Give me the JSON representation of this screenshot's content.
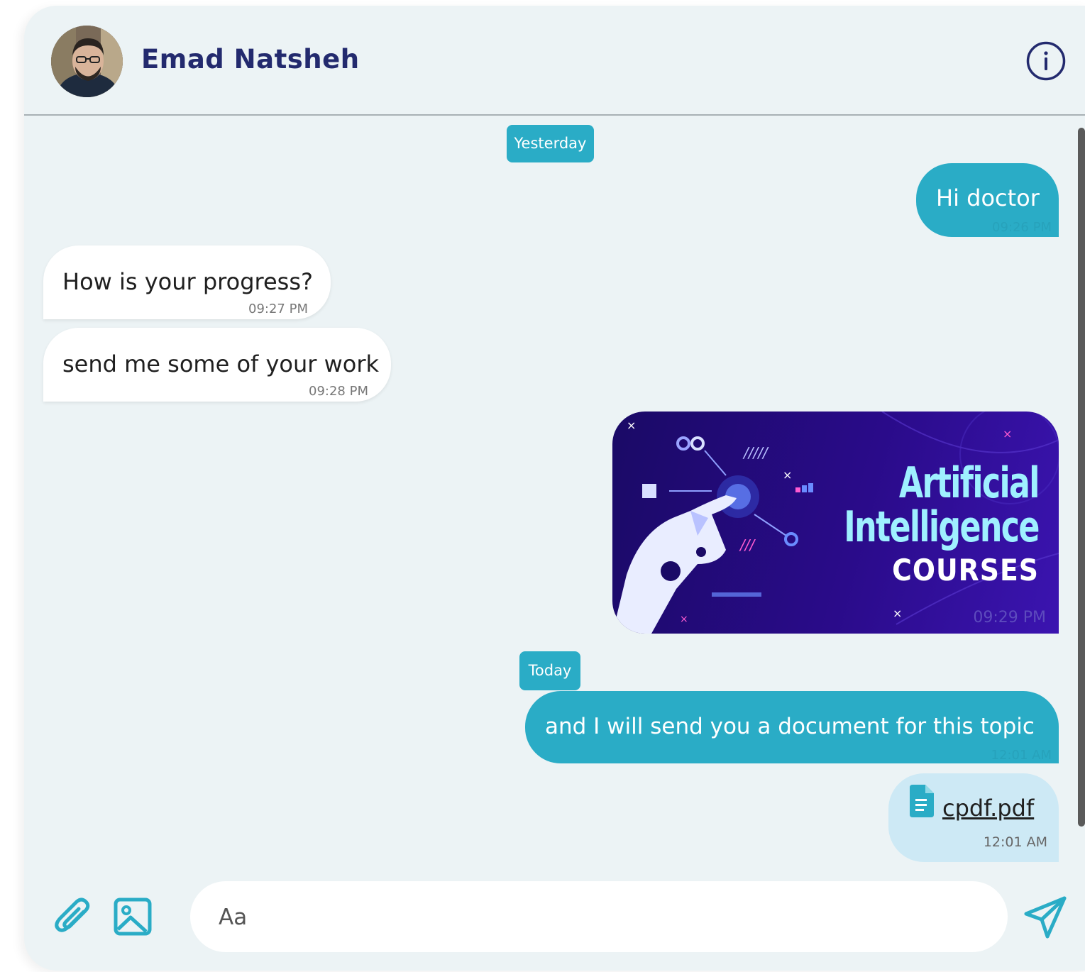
{
  "header": {
    "contact_name": "Emad Natsheh",
    "avatar_icon": "user-avatar",
    "info_icon": "info-icon"
  },
  "messages": [
    {
      "type": "date",
      "label": "Yesterday"
    },
    {
      "type": "out",
      "text": "Hi doctor",
      "time": "09:26 PM"
    },
    {
      "type": "in",
      "text": "How is your progress?",
      "time": "09:27 PM"
    },
    {
      "type": "in",
      "text": "send me some of your work",
      "time": "09:28 PM"
    },
    {
      "type": "out-image",
      "image_caption": {
        "line1": "Artificial",
        "line2": "Intelligence",
        "line3": "COURSES"
      },
      "time": "09:29 PM"
    },
    {
      "type": "date",
      "label": "Today"
    },
    {
      "type": "out",
      "text": "and I will send you a document for this topic",
      "time": "12:01 AM"
    },
    {
      "type": "out-file",
      "file_name": "cpdf.pdf",
      "file_icon": "document-icon",
      "time": "12:01 AM"
    }
  ],
  "composer": {
    "placeholder": "Aa",
    "attach_icon": "paperclip-icon",
    "image_icon": "image-icon",
    "send_icon": "send-icon"
  },
  "colors": {
    "accent": "#2aacc6",
    "name": "#232a6e",
    "background": "#ecf3f5",
    "file_bubble": "#cde9f5"
  }
}
